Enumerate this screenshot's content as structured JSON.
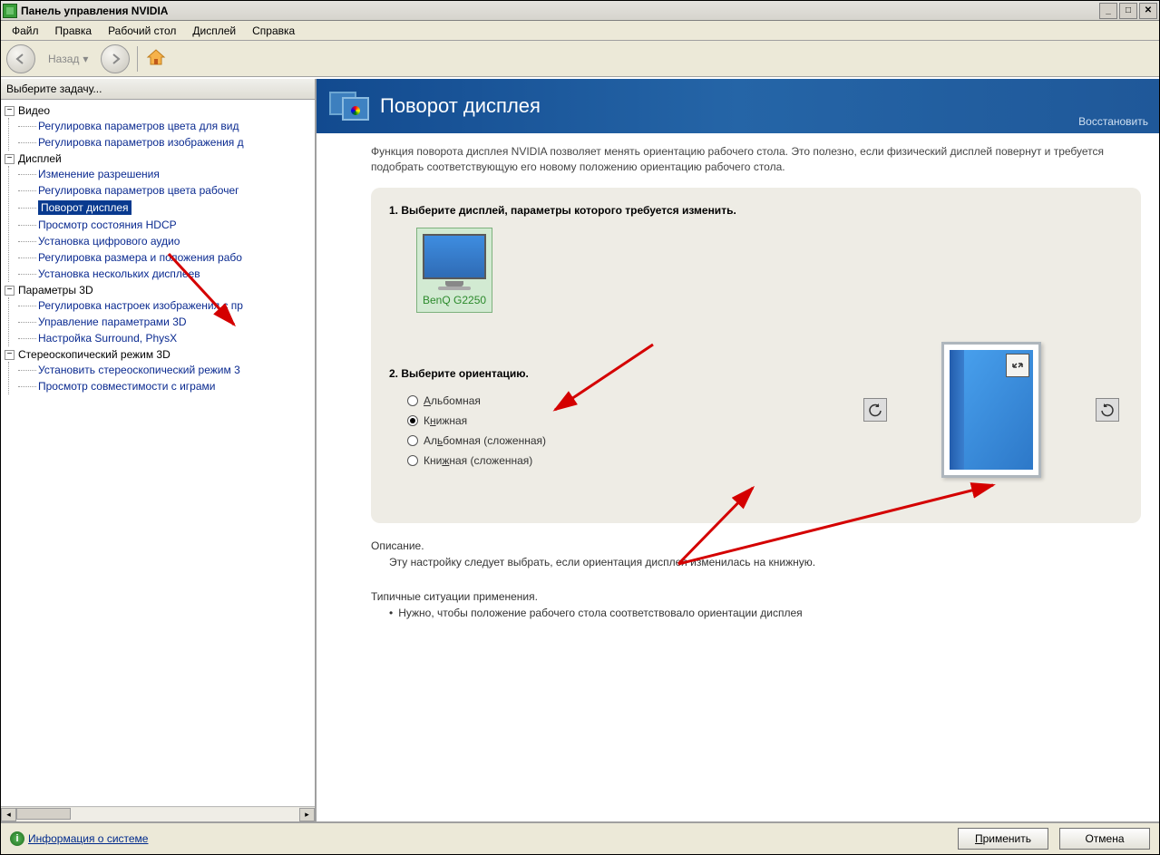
{
  "window": {
    "title": "Панель управления NVIDIA"
  },
  "menu": [
    "Файл",
    "Правка",
    "Рабочий стол",
    "Дисплей",
    "Справка"
  ],
  "toolbar": {
    "back": "Назад"
  },
  "sidebar": {
    "header": "Выберите задачу...",
    "categories": [
      {
        "label": "Видео",
        "items": [
          "Регулировка параметров цвета для вид",
          "Регулировка параметров изображения д"
        ]
      },
      {
        "label": "Дисплей",
        "items": [
          "Изменение разрешения",
          "Регулировка параметров цвета рабочег",
          "Поворот дисплея",
          "Просмотр состояния HDCP",
          "Установка цифрового аудио",
          "Регулировка размера и положения рабо",
          "Установка нескольких дисплеев"
        ],
        "selectedIndex": 2
      },
      {
        "label": "Параметры 3D",
        "items": [
          "Регулировка настроек изображения с пр",
          "Управление параметрами 3D",
          "Настройка Surround, PhysX"
        ]
      },
      {
        "label": "Стереоскопический режим 3D",
        "items": [
          "Установить стереоскопический режим 3",
          "Просмотр совместимости с играми"
        ]
      }
    ]
  },
  "main": {
    "title": "Поворот дисплея",
    "restore": "Восстановить",
    "intro": "Функция поворота дисплея NVIDIA позволяет менять ориентацию рабочего стола. Это полезно, если физический дисплей повернут и требуется подобрать соответствующую его новому положению ориентацию рабочего стола.",
    "step1": "1. Выберите дисплей, параметры которого требуется изменить.",
    "display_name": "BenQ G2250",
    "step2": "2. Выберите ориентацию.",
    "orientations": [
      {
        "label": "Альбомная",
        "ukey": "А"
      },
      {
        "label": "Книжная",
        "ukey": "н"
      },
      {
        "label": "Альбомная (сложенная)",
        "ukey": "ь"
      },
      {
        "label": "Книжная (сложенная)",
        "ukey": "ж"
      }
    ],
    "orientation_selected": 1,
    "description": {
      "head": "Описание.",
      "text": "Эту настройку следует выбрать, если ориентация дисплея изменилась на книжную.",
      "typical_head": "Типичные ситуации применения.",
      "typical_bullet": "Нужно, чтобы положение рабочего стола соответствовало ориентации дисплея"
    }
  },
  "footer": {
    "sysinfo": "Информация о системе",
    "apply": "Применить",
    "cancel": "Отмена"
  }
}
